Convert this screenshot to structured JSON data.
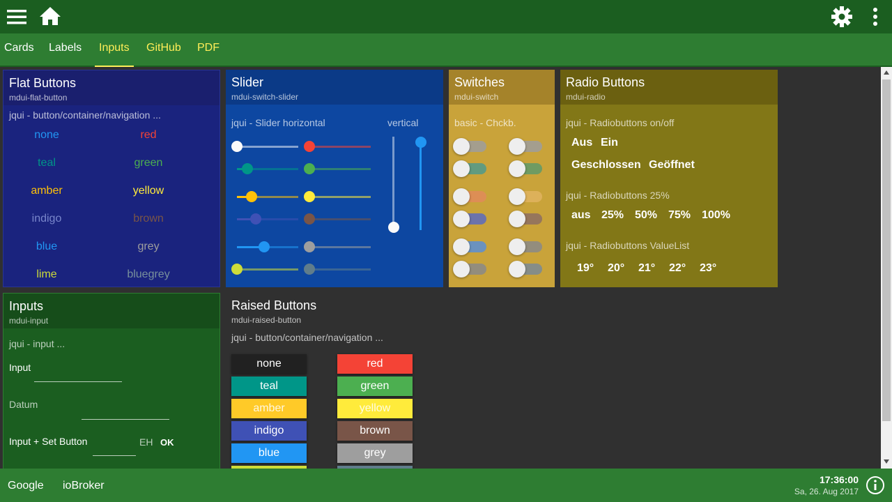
{
  "topbar": {
    "menu_icon": "hamburger-icon",
    "home_icon": "home-icon",
    "settings_icon": "gear-icon",
    "more_icon": "more-vert-icon"
  },
  "tabs": [
    "Cards",
    "Labels",
    "Inputs",
    "GitHub",
    "PDF"
  ],
  "active_tab": "Inputs",
  "flat_buttons": {
    "title": "Flat Buttons",
    "sub": "mdui-flat-button",
    "caption": "jqui - button/container/navigation ...",
    "left": [
      {
        "label": "none",
        "color": "#2196f3"
      },
      {
        "label": "teal",
        "color": "#009688"
      },
      {
        "label": "amber",
        "color": "#ffc107"
      },
      {
        "label": "indigo",
        "color": "#7986cb"
      },
      {
        "label": "blue",
        "color": "#2196f3"
      },
      {
        "label": "lime",
        "color": "#cddc39"
      }
    ],
    "right": [
      {
        "label": "red",
        "color": "#f44336"
      },
      {
        "label": "green",
        "color": "#4caf50"
      },
      {
        "label": "yellow",
        "color": "#ffeb3b"
      },
      {
        "label": "brown",
        "color": "#795548"
      },
      {
        "label": "grey",
        "color": "#9e9e9e"
      },
      {
        "label": "bluegrey",
        "color": "#78909c"
      }
    ]
  },
  "slider": {
    "title": "Slider",
    "sub": "mdui-switch-slider",
    "caption_h": "jqui - Slider horizontal",
    "caption_v": "vertical",
    "left_values": [
      0,
      17,
      24,
      31,
      44,
      0
    ],
    "right_values": [
      0,
      0,
      0,
      0,
      0,
      0
    ],
    "vertical_values": [
      0,
      83
    ]
  },
  "switches": {
    "title": "Switches",
    "sub": "mdui-switch",
    "caption": "basic - Chckb."
  },
  "radio": {
    "title": "Radio Buttons",
    "sub": "mdui-radio",
    "cap1": "jqui - Radiobuttons on/off",
    "opts1a": [
      "Aus",
      "Ein"
    ],
    "opts1b": [
      "Geschlossen",
      "Geöffnet"
    ],
    "cap2": "jqui - Radiobuttons 25%",
    "opts2": [
      "aus",
      "25%",
      "50%",
      "75%",
      "100%"
    ],
    "cap3": "jqui - Radiobuttons ValueList",
    "opts3": [
      "19°",
      "20°",
      "21°",
      "22°",
      "23°"
    ]
  },
  "inputs": {
    "title": "Inputs",
    "sub": "mdui-input",
    "caption": "jqui - input ...",
    "input_label": "Input",
    "datum_label": "Datum",
    "set_label": "Input + Set Button",
    "unit": "EH",
    "ok": "OK"
  },
  "raised": {
    "title": "Raised Buttons",
    "sub": "mdui-raised-button",
    "caption": "jqui - button/container/navigation ...",
    "left": [
      {
        "label": "none",
        "color": "#212121"
      },
      {
        "label": "teal",
        "color": "#009688"
      },
      {
        "label": "amber",
        "color": "#ffca28"
      },
      {
        "label": "indigo",
        "color": "#3f51b5"
      },
      {
        "label": "blue",
        "color": "#2196f3"
      }
    ],
    "right": [
      {
        "label": "red",
        "color": "#f44336"
      },
      {
        "label": "green",
        "color": "#4caf50"
      },
      {
        "label": "yellow",
        "color": "#ffeb3b"
      },
      {
        "label": "brown",
        "color": "#795548"
      },
      {
        "label": "grey",
        "color": "#9e9e9e"
      }
    ]
  },
  "footer": {
    "links": [
      "Google",
      "ioBroker"
    ],
    "time": "17:36:00",
    "date": "Sa, 26. Aug 2017",
    "info_icon": "info-icon"
  }
}
